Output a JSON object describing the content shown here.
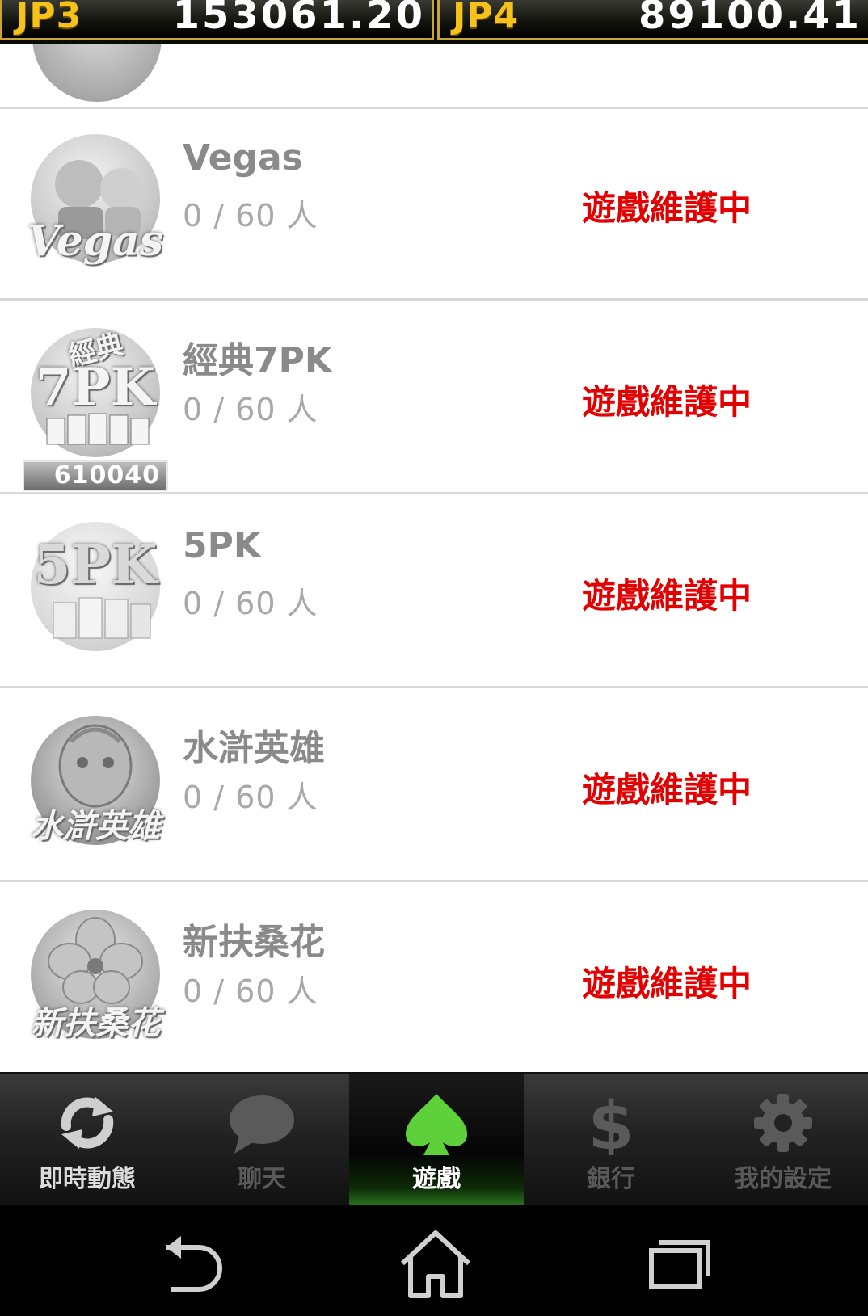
{
  "jackpots": [
    {
      "label": "JP3",
      "value": "153061.20"
    },
    {
      "label": "JP4",
      "value": "89100.41"
    }
  ],
  "games": [
    {
      "title": "Vegas",
      "count": "0 / 60 人",
      "status": "遊戲維護中",
      "icon": "vegas-logo-icon"
    },
    {
      "title": "經典7PK",
      "count": "0 / 60 人",
      "status": "遊戲維護中",
      "icon": "classic-7pk-logo-icon",
      "badge": "610040"
    },
    {
      "title": "5PK",
      "count": "0 / 60 人",
      "status": "遊戲維護中",
      "icon": "5pk-logo-icon"
    },
    {
      "title": "水滸英雄",
      "count": "0 / 60 人",
      "status": "遊戲維護中",
      "icon": "water-margin-logo-icon"
    },
    {
      "title": "新扶桑花",
      "count": "0 / 60 人",
      "status": "遊戲維護中",
      "icon": "hibiscus-logo-icon"
    }
  ],
  "tabs": [
    {
      "label": "即時動態",
      "icon": "refresh-icon"
    },
    {
      "label": "聊天",
      "icon": "chat-bubble-icon"
    },
    {
      "label": "遊戲",
      "icon": "spade-icon",
      "active": true
    },
    {
      "label": "銀行",
      "icon": "dollar-icon"
    },
    {
      "label": "我的設定",
      "icon": "gear-icon"
    }
  ],
  "nav": [
    "back-icon",
    "home-icon",
    "recent-apps-icon"
  ],
  "colors": {
    "status": "#e30000",
    "jp_label": "#f6c21a",
    "active_tab": "#2c7d1f",
    "spade": "#5ed13a"
  }
}
